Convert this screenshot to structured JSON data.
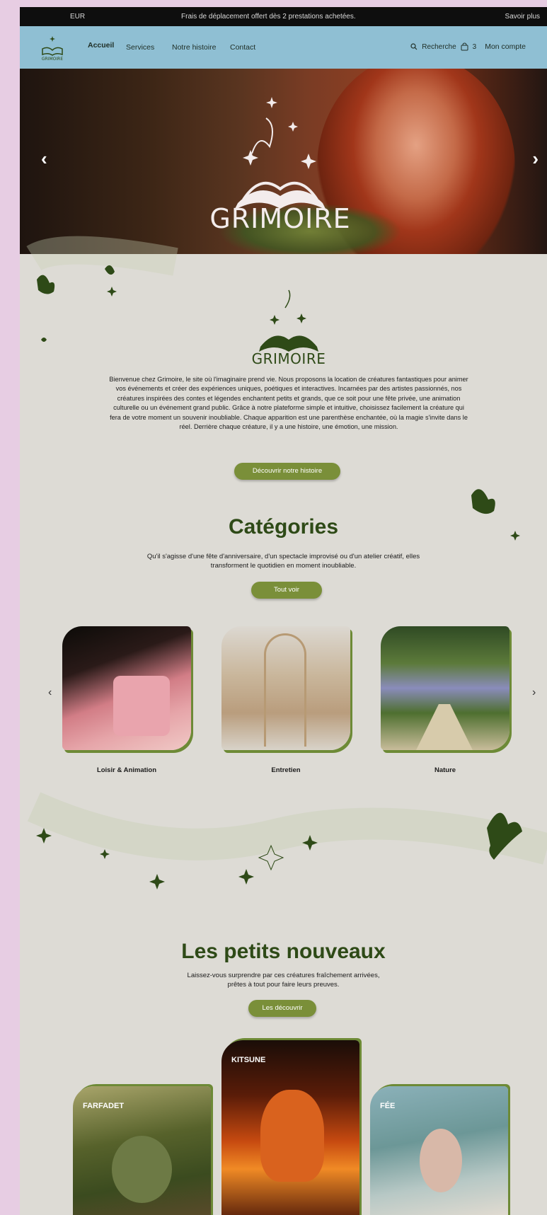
{
  "announcement": {
    "currency": "EUR",
    "message": "Frais de déplacement offert dès 2 prestations achetées.",
    "more_link": "Savoir plus"
  },
  "header": {
    "logo_text": "GRIMOIRE",
    "nav": [
      "Accueil",
      "Services",
      "Notre histoire",
      "Contact"
    ],
    "search_label": "Recherche",
    "cart_count": "3",
    "account_label": "Mon compte"
  },
  "hero": {
    "title": "GRIMOIRE",
    "prev_icon": "chevron-left-icon",
    "next_icon": "chevron-right-icon"
  },
  "intro": {
    "brand": "GRIMOIRE",
    "text": "Bienvenue chez Grimoire, le site où l'imaginaire prend vie. Nous proposons la location de créatures fantastiques pour animer vos événements et créer des expériences uniques, poétiques et interactives. Incarnées par des artistes passionnés, nos créatures inspirées des contes et légendes enchantent petits et grands, que ce soit pour une fête privée, une animation culturelle ou un événement grand public. Grâce à notre plateforme simple et intuitive, choisissez facilement la créature qui fera de votre moment un souvenir inoubliable. Chaque apparition est une parenthèse enchantée, où la magie s'invite dans le réel. Derrière chaque créature, il y a une histoire, une émotion, une mission.",
    "button": "Découvrir notre histoire"
  },
  "categories": {
    "title": "Catégories",
    "subtitle": "Qu'il s'agisse d'une fête d'anniversaire, d'un spectacle improvisé ou d'un atelier créatif, elles transforment le quotidien en moment inoubliable.",
    "button": "Tout voir",
    "items": [
      {
        "label": "Loisir & Animation"
      },
      {
        "label": "Entretien"
      },
      {
        "label": "Nature"
      }
    ]
  },
  "new_arrivals": {
    "title": "Les petits nouveaux",
    "subtitle": "Laissez-vous surprendre par ces créatures fraîchement arrivées, prêtes à tout pour faire leurs preuves.",
    "button": "Les découvrir",
    "items": [
      {
        "label": "FARFADET"
      },
      {
        "label": "KITSUNE"
      },
      {
        "label": "FÉE"
      }
    ]
  },
  "colors": {
    "accent": "#7a8f39",
    "title_green": "#2e4a17",
    "header_blue": "#8fbfd3",
    "background": "#dddbd5"
  }
}
